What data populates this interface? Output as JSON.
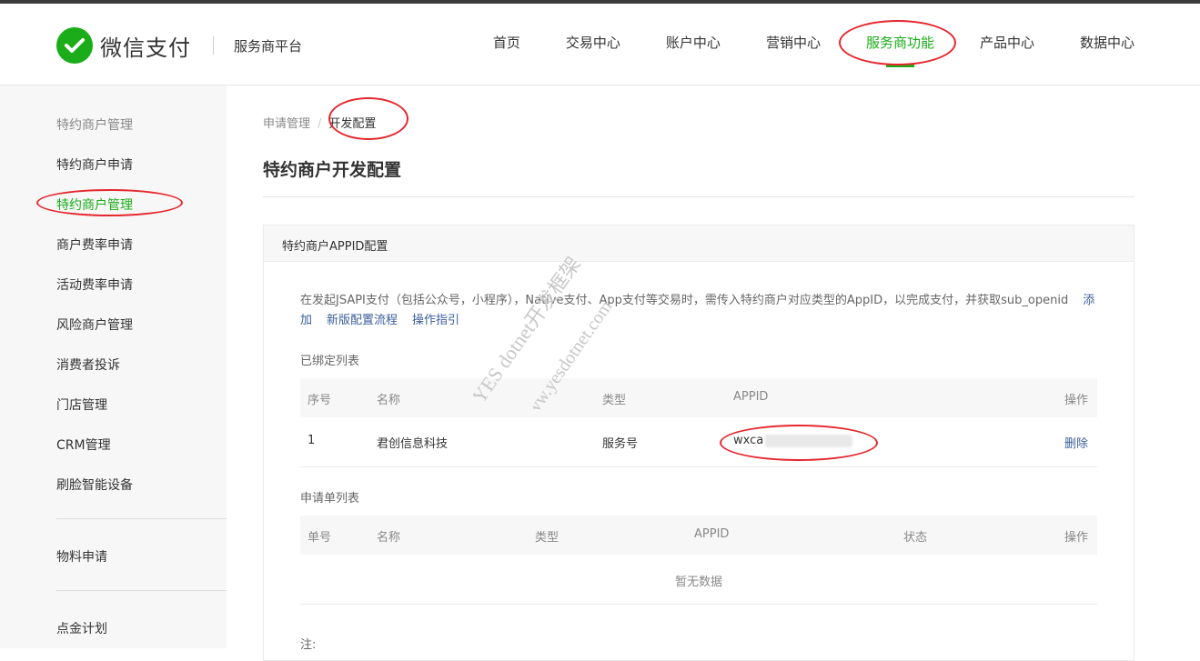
{
  "header": {
    "logo_text": "微信支付",
    "platform": "服务商平台",
    "nav": [
      {
        "label": "首页"
      },
      {
        "label": "交易中心"
      },
      {
        "label": "账户中心"
      },
      {
        "label": "营销中心"
      },
      {
        "label": "服务商功能",
        "active": true
      },
      {
        "label": "产品中心"
      },
      {
        "label": "数据中心"
      }
    ]
  },
  "sidebar": {
    "items": [
      {
        "label": "特约商户管理",
        "type": "group"
      },
      {
        "label": "特约商户申请"
      },
      {
        "label": "特约商户管理",
        "active": true
      },
      {
        "label": "商户费率申请"
      },
      {
        "label": "活动费率申请"
      },
      {
        "label": "风险商户管理"
      },
      {
        "label": "消费者投诉"
      },
      {
        "label": "门店管理"
      },
      {
        "label": "CRM管理"
      },
      {
        "label": "刷脸智能设备"
      },
      {
        "label": "物料申请"
      },
      {
        "label": "点金计划"
      }
    ]
  },
  "breadcrumb": {
    "parent": "申请管理",
    "separator": "/",
    "current": "开发配置"
  },
  "page_title": "特约商户开发配置",
  "panel": {
    "title": "特约商户APPID配置",
    "description": "在发起JSAPI支付（包括公众号，小程序），Native支付、App支付等交易时，需传入特约商户对应类型的AppID，以完成支付，并获取sub_openid",
    "links": {
      "add": "添加",
      "new_flow": "新版配置流程",
      "guide": "操作指引"
    },
    "bound_title": "已绑定列表",
    "bound_table": {
      "headers": {
        "index": "序号",
        "name": "名称",
        "type": "类型",
        "appid": "APPID",
        "action": "操作"
      },
      "rows": [
        {
          "index": "1",
          "name": "君创信息科技",
          "type": "服务号",
          "appid": "wxca",
          "action": "删除"
        }
      ]
    },
    "apply_title": "申请单列表",
    "apply_table": {
      "headers": {
        "no": "单号",
        "name": "名称",
        "type": "类型",
        "appid": "APPID",
        "status": "状态",
        "action": "操作"
      },
      "empty": "暂无数据"
    },
    "note": "注:"
  },
  "watermark": {
    "line1": "YES dotnet开发框架",
    "line2": "www.yesdotnet.com"
  },
  "colors": {
    "brand": "#1aad19",
    "link": "#3a5d9c",
    "annotation": "#e6262d"
  }
}
